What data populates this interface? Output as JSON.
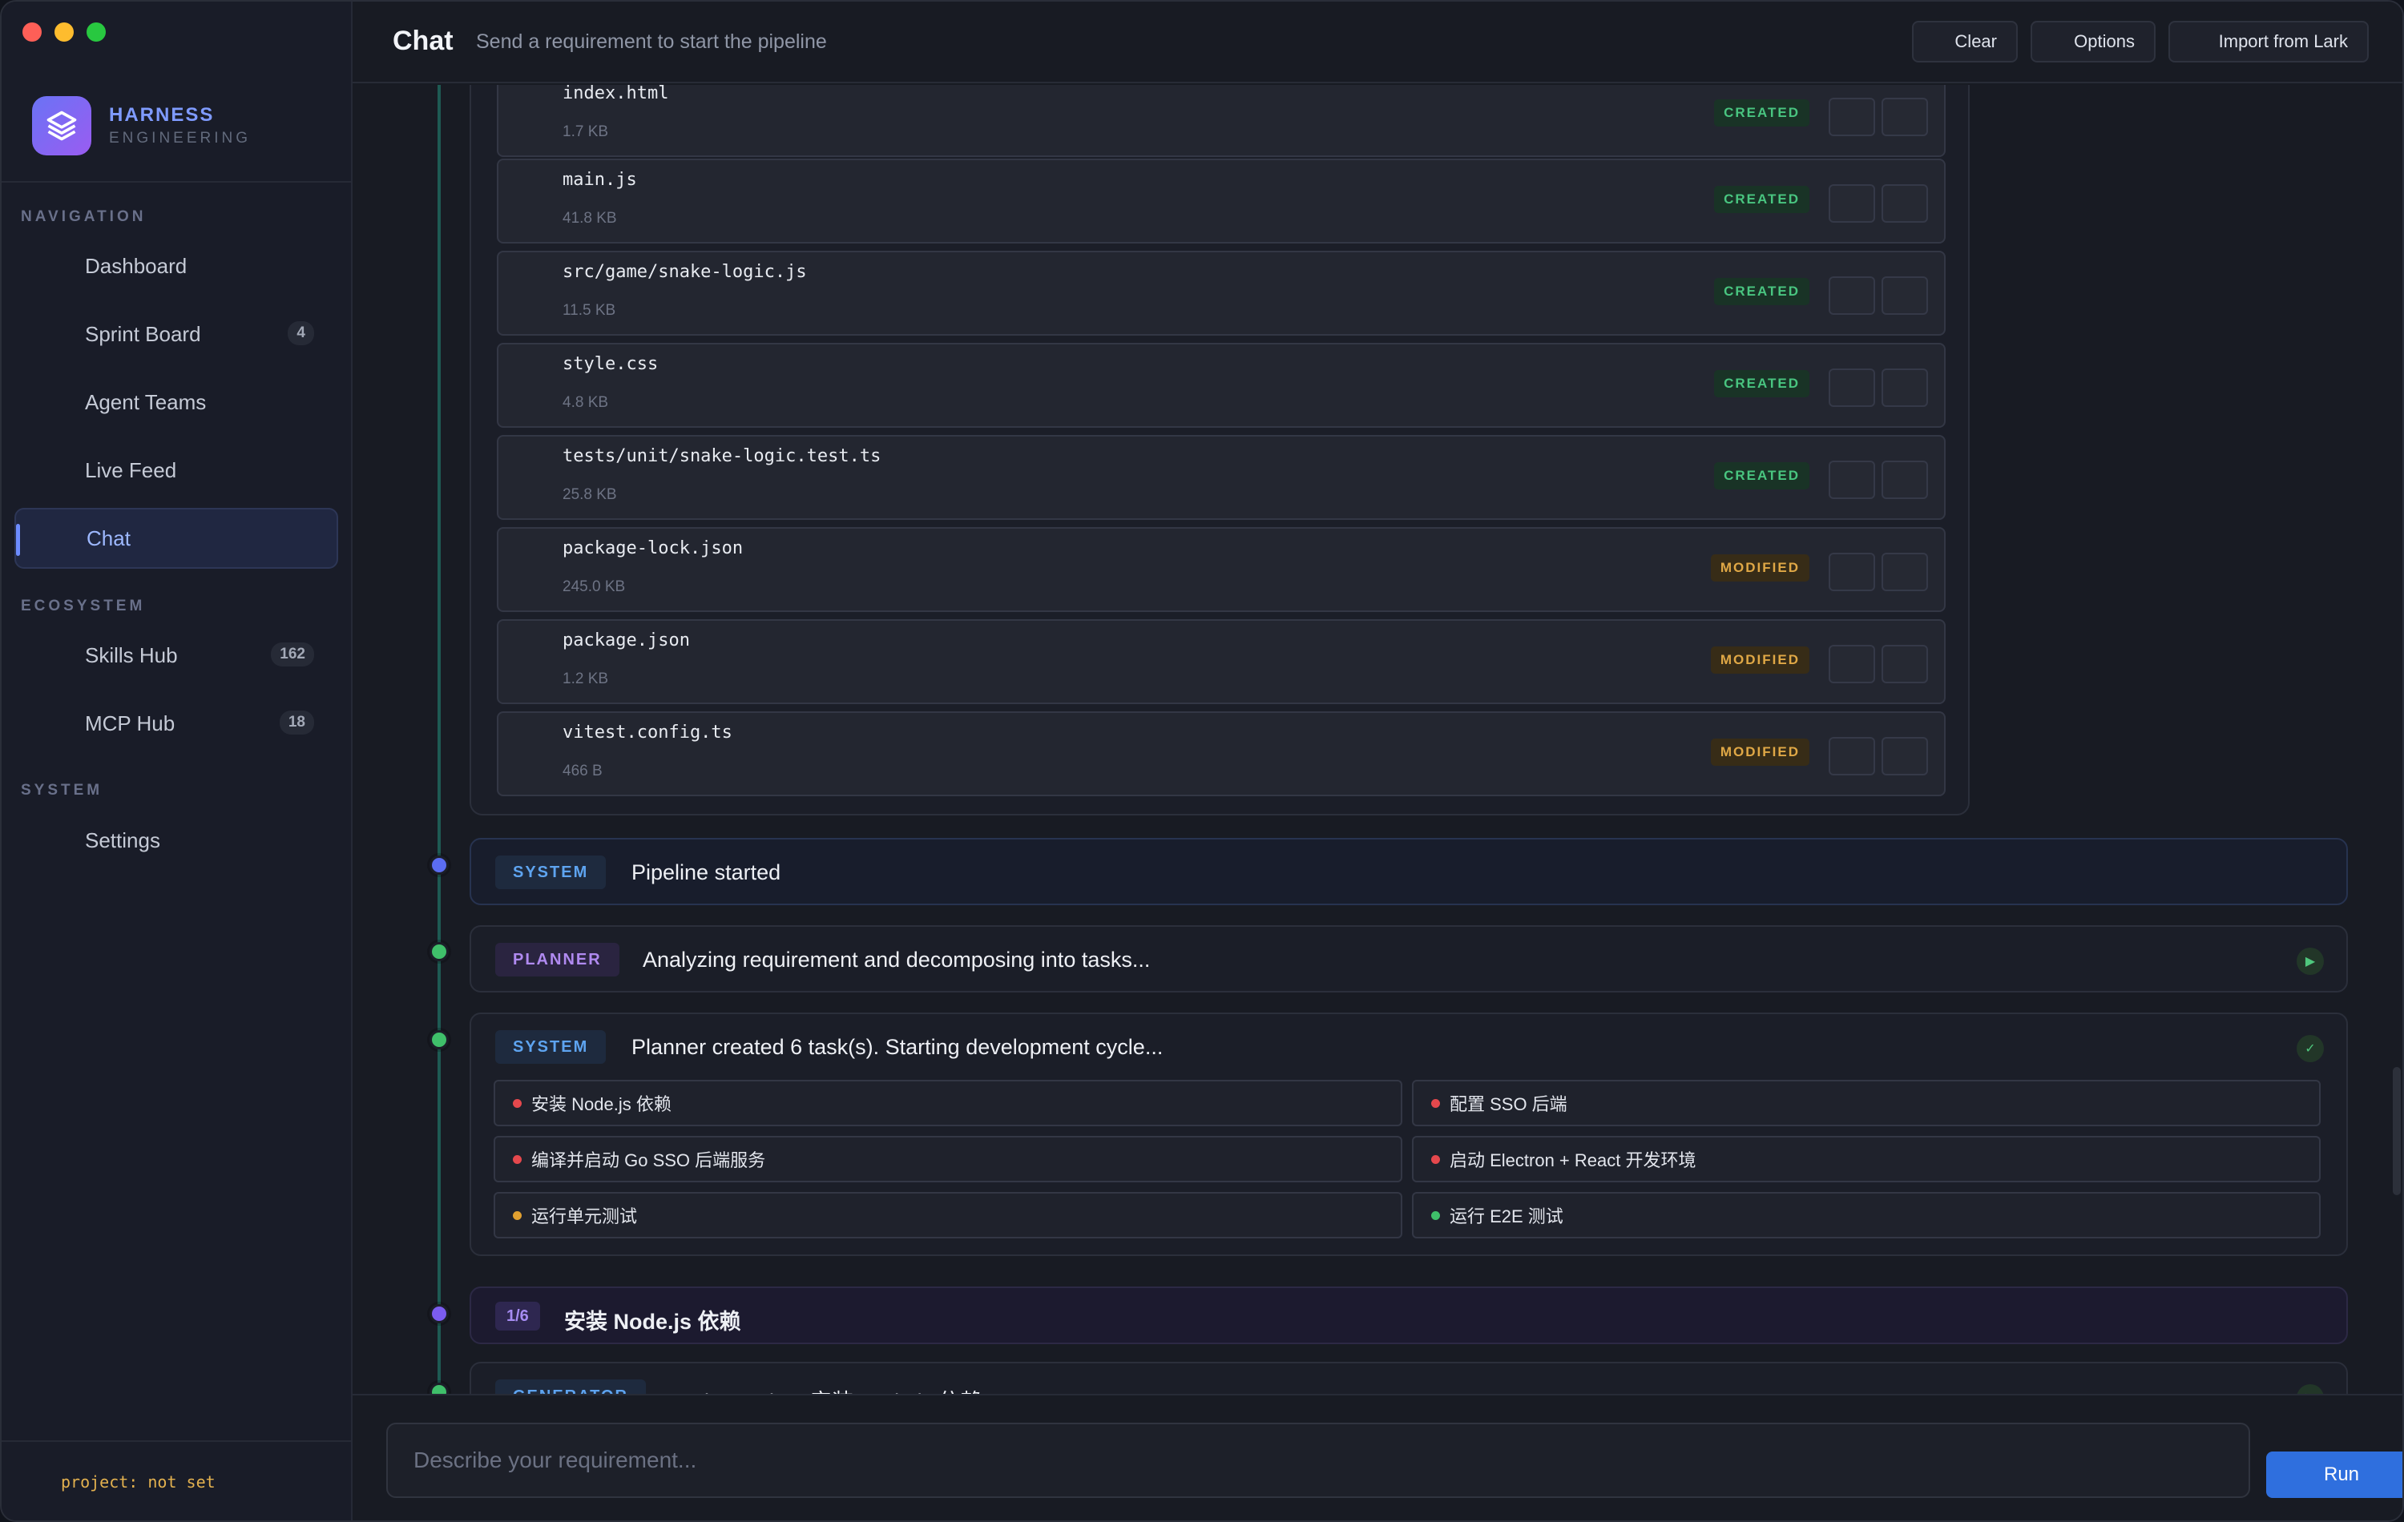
{
  "sidebar": {
    "brand": {
      "title": "HARNESS",
      "subtitle": "ENGINEERING"
    },
    "sections": {
      "navigation": "NAVIGATION",
      "ecosystem": "ECOSYSTEM",
      "system": "SYSTEM"
    },
    "items": [
      {
        "label": "Dashboard"
      },
      {
        "label": "Sprint Board",
        "badge": "4"
      },
      {
        "label": "Agent Teams"
      },
      {
        "label": "Live Feed"
      },
      {
        "label": "Chat",
        "active": true
      },
      {
        "label": "Skills Hub",
        "badge": "162"
      },
      {
        "label": "MCP Hub",
        "badge": "18"
      },
      {
        "label": "Settings"
      }
    ],
    "project": "project: not set"
  },
  "header": {
    "title": "Chat",
    "subtitle": "Send a requirement to start the pipeline",
    "buttons": {
      "clear": "Clear",
      "options": "Options",
      "import": "Import from Lark"
    }
  },
  "files": [
    {
      "name": "index.html",
      "size": "1.7 KB",
      "status": "CREATED"
    },
    {
      "name": "main.js",
      "size": "41.8 KB",
      "status": "CREATED"
    },
    {
      "name": "src/game/snake-logic.js",
      "size": "11.5 KB",
      "status": "CREATED"
    },
    {
      "name": "style.css",
      "size": "4.8 KB",
      "status": "CREATED"
    },
    {
      "name": "tests/unit/snake-logic.test.ts",
      "size": "25.8 KB",
      "status": "CREATED"
    },
    {
      "name": "package-lock.json",
      "size": "245.0 KB",
      "status": "MODIFIED"
    },
    {
      "name": "package.json",
      "size": "1.2 KB",
      "status": "MODIFIED"
    },
    {
      "name": "vitest.config.ts",
      "size": "466 B",
      "status": "MODIFIED"
    }
  ],
  "events": {
    "pipeline_started": {
      "tag": "SYSTEM",
      "text": "Pipeline started"
    },
    "planner": {
      "tag": "PLANNER",
      "text": "Analyzing requirement and decomposing into tasks..."
    },
    "tasks_created": {
      "tag": "SYSTEM",
      "text": "Planner created 6 task(s). Starting development cycle..."
    },
    "generator": {
      "tag": "GENERATOR",
      "text": "Implementing: 安装 Node.js 依赖"
    }
  },
  "tasks": [
    {
      "label": "安装 Node.js 依赖",
      "status_color": "#e5484d"
    },
    {
      "label": "配置 SSO 后端",
      "status_color": "#e5484d"
    },
    {
      "label": "编译并启动 Go SSO 后端服务",
      "status_color": "#e5484d"
    },
    {
      "label": "启动 Electron + React 开发环境",
      "status_color": "#e5484d"
    },
    {
      "label": "运行单元测试",
      "status_color": "#e0a030"
    },
    {
      "label": "运行 E2E 测试",
      "status_color": "#3fbf6a"
    }
  ],
  "step": {
    "counter": "1/6",
    "title": "安装 Node.js 依赖"
  },
  "composer": {
    "placeholder": "Describe your requirement...",
    "run_label": "Run"
  },
  "colors": {
    "accent": "#2f6fde",
    "created": "#49c580",
    "modified": "#e0a846",
    "dot_blue": "#5b6df2",
    "dot_green": "#3fbf6a",
    "dot_purple": "#7b5cf0"
  }
}
